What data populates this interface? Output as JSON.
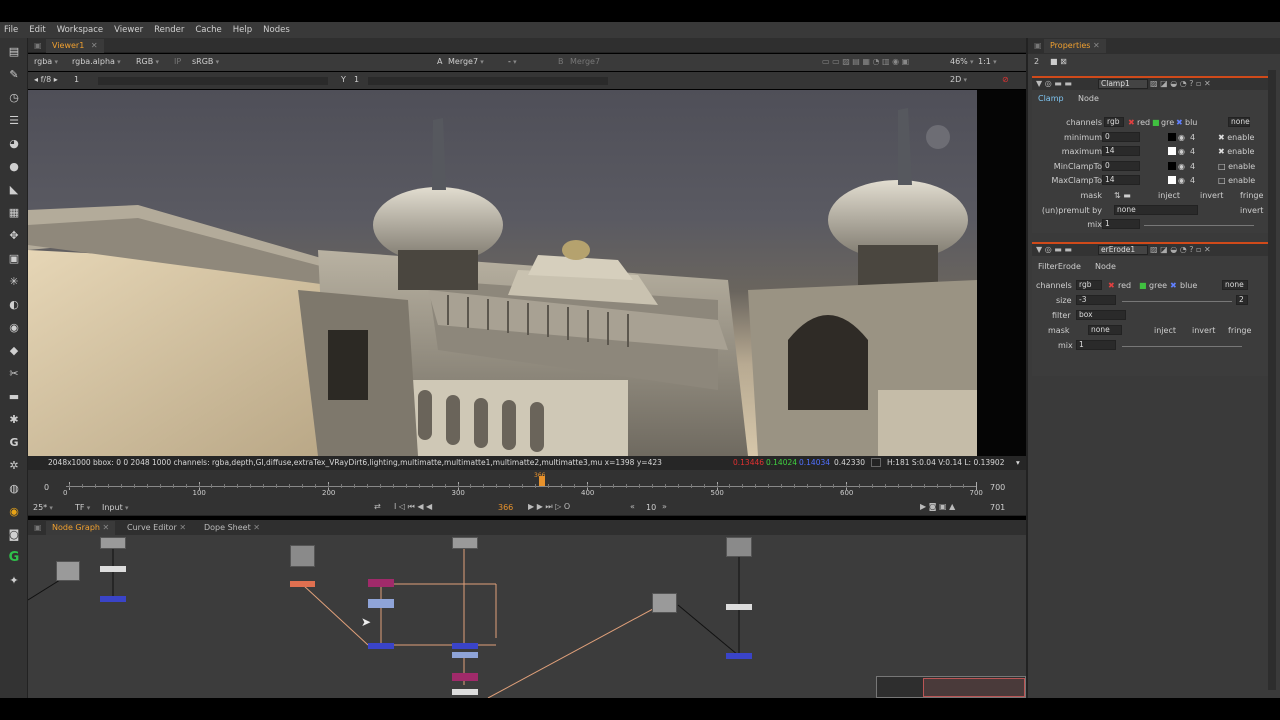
{
  "menu": [
    "File",
    "Edit",
    "Workspace",
    "Viewer",
    "Render",
    "Cache",
    "Help",
    "Nodes"
  ],
  "viewer_tab": "Viewer1",
  "viewer_ctrl": {
    "channels": "rgba",
    "alpha": "rgba.alpha",
    "display": "RGB",
    "ip": "IP",
    "lut": "sRGB",
    "a_label": "A",
    "a_input": "Merge7",
    "a_op": "-",
    "b_label": "B",
    "b_input": "Merge7",
    "zoom": "46%",
    "ratio": "1:1",
    "fstop": "f/8",
    "frame": "1",
    "y_label": "Y",
    "y_value": "1",
    "mode": "2D"
  },
  "info": {
    "main": "2048x1000  bbox: 0 0 2048 1000 channels: rgba,depth,GI,diffuse,extraTex_VRayDirt6,lighting,multimatte,multimatte1,multimatte2,multimatte3,mu  x=1398 y=423",
    "r": "0.13446",
    "g": "0.14024",
    "b": "0.14034",
    "a": "0.42330",
    "hsv": "H:181 S:0.04 V:0.14  L: 0.13902"
  },
  "timeline": {
    "ticks": [
      "0",
      "100",
      "200",
      "300",
      "400",
      "500",
      "600",
      "700"
    ],
    "start": "0",
    "end": "700",
    "current_marker": "366",
    "fps": "25*",
    "tf": "TF",
    "input": "Input",
    "frame": "366",
    "step": "10",
    "last": "701"
  },
  "ng_tabs": [
    "Node Graph",
    "Curve Editor",
    "Dope Sheet"
  ],
  "props": {
    "tab": "Properties",
    "clamp": {
      "name": "Clamp1",
      "tabs": [
        "Clamp",
        "Node"
      ],
      "rows": [
        {
          "label": "channels",
          "value": "rgb"
        },
        {
          "label": "minimum",
          "value": "0"
        },
        {
          "label": "maximum",
          "value": "14"
        },
        {
          "label": "MinClampTo",
          "value": "0"
        },
        {
          "label": "MaxClampTo",
          "value": "14"
        },
        {
          "label": "mask",
          "value": ""
        },
        {
          "label": "(un)premult by",
          "value": "none"
        },
        {
          "label": "mix",
          "value": "1"
        }
      ],
      "red": "red",
      "green": "gre",
      "blue": "blu",
      "none": "none",
      "enable": "enable",
      "inject": "inject",
      "invert": "invert",
      "fringe": "fringe",
      "four": "4"
    },
    "erode": {
      "name": "erErode1",
      "tabs": [
        "FilterErode",
        "Node"
      ],
      "channels": "rgb",
      "red": "red",
      "green": "gree",
      "blue": "blue",
      "none": "none",
      "size_label": "size",
      "size": "-3",
      "filter_label": "filter",
      "filter": "box",
      "mask_label": "mask",
      "mask": "none",
      "mix_label": "mix",
      "mix": "1",
      "inject": "inject",
      "invert": "invert",
      "fringe": "fringe",
      "two": "2"
    }
  }
}
